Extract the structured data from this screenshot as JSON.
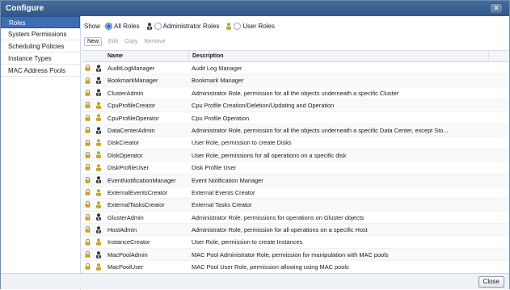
{
  "window": {
    "title": "Configure"
  },
  "sidebar": {
    "items": [
      {
        "label": "Roles"
      },
      {
        "label": "System Permissions"
      },
      {
        "label": "Scheduling Policies"
      },
      {
        "label": "Instance Types"
      },
      {
        "label": "MAC Address Pools"
      }
    ]
  },
  "filter": {
    "show_label": "Show",
    "all_roles": "All Roles",
    "admin_roles": "Administrator Roles",
    "user_roles": "User Roles",
    "selected": "All Roles"
  },
  "toolbar": {
    "new": "New",
    "edit": "Edit",
    "copy": "Copy",
    "remove": "Remove"
  },
  "grid": {
    "headers": {
      "name": "Name",
      "description": "Description"
    },
    "rows": [
      {
        "name": "AuditLogManager",
        "type": "admin",
        "description": "Audit Log Manager"
      },
      {
        "name": "BookmarkManager",
        "type": "admin",
        "description": "Bookmark Manager"
      },
      {
        "name": "ClusterAdmin",
        "type": "admin",
        "description": "Administrator Role, permission for all the objects underneath a specific Cluster"
      },
      {
        "name": "CpuProfileCreator",
        "type": "user",
        "description": "Cpu Profile Creation/Deletion/Updating and Operation"
      },
      {
        "name": "CpuProfileOperator",
        "type": "user",
        "description": "Cpu Profile Operation"
      },
      {
        "name": "DataCenterAdmin",
        "type": "admin",
        "description": "Administrator Role, permission for all the objects underneath a specific Data Center, except Sto..."
      },
      {
        "name": "DiskCreator",
        "type": "user",
        "description": "User Role, permission to create Disks"
      },
      {
        "name": "DiskOperator",
        "type": "user",
        "description": "User Role, permissions for all operations on a specific disk"
      },
      {
        "name": "DiskProfileUser",
        "type": "user",
        "description": "Disk Profile User"
      },
      {
        "name": "EventNotificationManager",
        "type": "admin",
        "description": "Event Notification Manager"
      },
      {
        "name": "ExternalEventsCreator",
        "type": "user",
        "description": "External Events Creator"
      },
      {
        "name": "ExternalTasksCreator",
        "type": "user",
        "description": "External Tasks Creator"
      },
      {
        "name": "GlusterAdmin",
        "type": "admin",
        "description": "Administrator Role, permissions for operations on Gluster objects"
      },
      {
        "name": "HostAdmin",
        "type": "admin",
        "description": "Administrator Role, permission for all operations on a specific Host"
      },
      {
        "name": "InstanceCreator",
        "type": "user",
        "description": "User Role, permission to create Instances"
      },
      {
        "name": "MacPoolAdmin",
        "type": "admin",
        "description": "MAC Pool Administrator Role, permission for manipulation with MAC pools"
      },
      {
        "name": "MacPoolUser",
        "type": "user",
        "description": "MAC Pool User Role, permission allowing using MAC pools"
      }
    ]
  },
  "footer": {
    "close": "Close"
  },
  "colors": {
    "titlebar": "#3a6293",
    "selected": "#3c6db5",
    "lock": "#c9a227",
    "admin_icon": "#3a3a3a",
    "user_icon": "#c9a227"
  }
}
